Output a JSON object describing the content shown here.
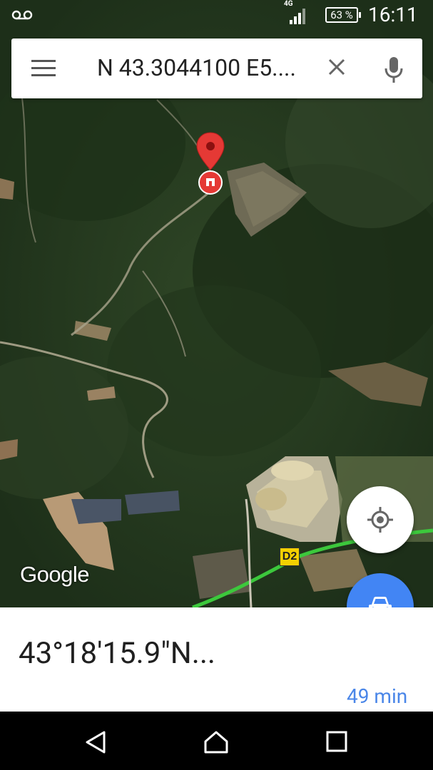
{
  "status_bar": {
    "network": "4G",
    "battery": "63 %",
    "time": "16:11"
  },
  "search": {
    "query": "N 43.3044100 E5...."
  },
  "map": {
    "logo": "Google",
    "road_label": "D2"
  },
  "place": {
    "coordinates": "43°18'15.9\"N...",
    "eta": "49 min"
  },
  "colors": {
    "directions_fab": "#4285f4",
    "eta_text": "#4a86e8",
    "route_line": "#3cc83c",
    "pin": "#e53935"
  }
}
